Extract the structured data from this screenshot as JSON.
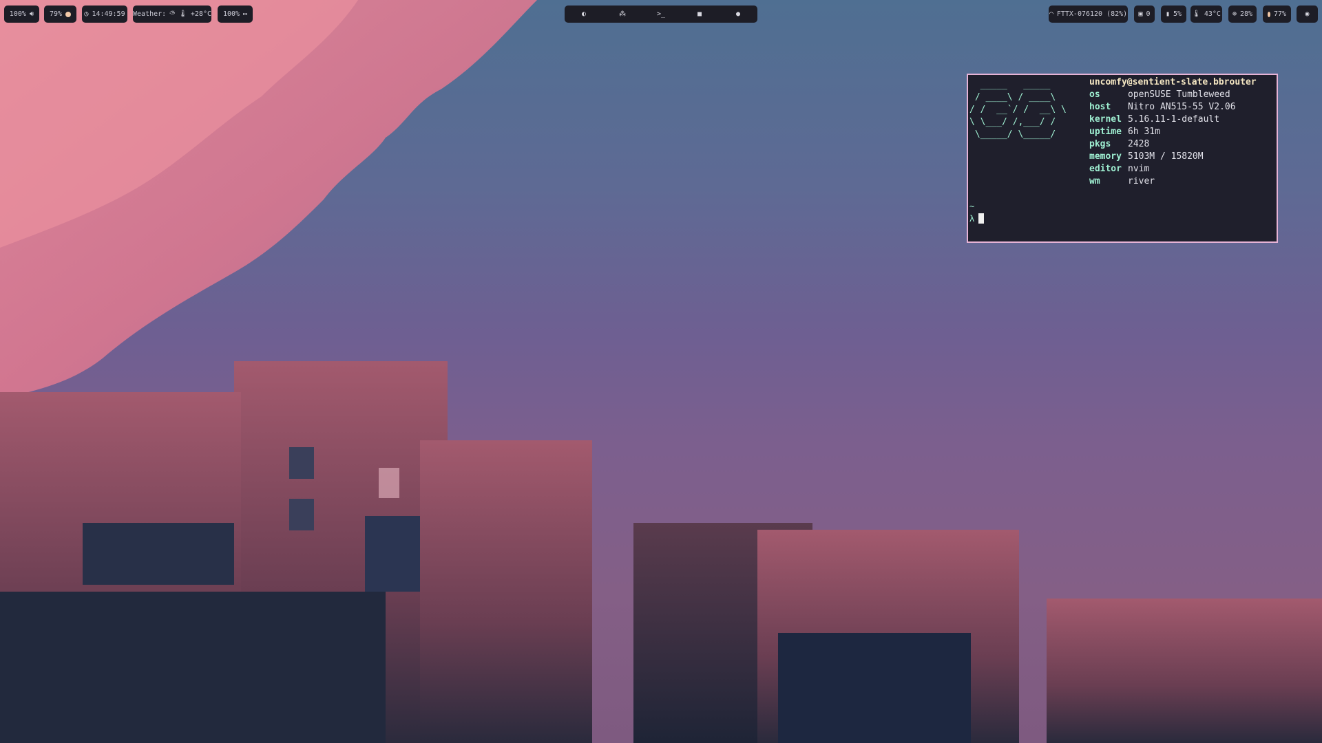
{
  "bar": {
    "left": {
      "volume": {
        "text": "100%",
        "icon": "volume-icon"
      },
      "brightness": {
        "text": "79%",
        "icon": "brightness-dot-icon"
      },
      "clock": {
        "icon": "clock-icon",
        "text": "14:49:59"
      },
      "weather": {
        "label": "Weather:",
        "icon": "cloud-sun-icon",
        "temp_icon": "thermometer-icon",
        "temp": "+28°C"
      },
      "battery": {
        "text": "100%",
        "icon": "battery-icon"
      }
    },
    "center": {
      "items": [
        {
          "icon": "firefox-icon"
        },
        {
          "icon": "network-nodes-icon"
        },
        {
          "icon": "terminal-icon",
          "text": ">_"
        },
        {
          "icon": "folder-icon"
        },
        {
          "icon": "user-icon"
        }
      ]
    },
    "right": {
      "wifi": {
        "icon": "wifi-icon",
        "text": "FTTX-076120 (82%)"
      },
      "updates": {
        "icon": "package-icon",
        "text": "0"
      },
      "disk": {
        "icon": "disk-icon",
        "text": "5%"
      },
      "temperature": {
        "icon": "thermometer-icon",
        "text": "43°C"
      },
      "cpu": {
        "icon": "cpu-icon",
        "text": "28%"
      },
      "memory": {
        "icon": "memory-dot-icon",
        "text": "77%"
      },
      "steam": {
        "icon": "steam-icon"
      }
    }
  },
  "terminal": {
    "ascii_art": [
      "  _____   _____  ",
      " / ____\\ / ____\\ ",
      "/ /  __`/ /  __\\ \\",
      "\\ \\___/ /,___/ / ",
      " \\_____/ \\_____/ "
    ],
    "header": "uncomfy@sentient-slate.bbrouter",
    "rows": [
      {
        "key": "os",
        "value": "openSUSE Tumbleweed"
      },
      {
        "key": "host",
        "value": "Nitro AN515-55 V2.06"
      },
      {
        "key": "kernel",
        "value": "5.16.11-1-default"
      },
      {
        "key": "uptime",
        "value": "6h 31m"
      },
      {
        "key": "pkgs",
        "value": "2428"
      },
      {
        "key": "memory",
        "value": "5103M / 15820M"
      },
      {
        "key": "editor",
        "value": "nvim"
      },
      {
        "key": "wm",
        "value": "river"
      }
    ],
    "cwd": "~",
    "prompt": "λ"
  },
  "colors": {
    "bar_bg": "#1d1d26",
    "terminal_border": "#e6b3d6",
    "accent_green": "#9ff0d2",
    "header_yellow": "#f4e6c2"
  }
}
